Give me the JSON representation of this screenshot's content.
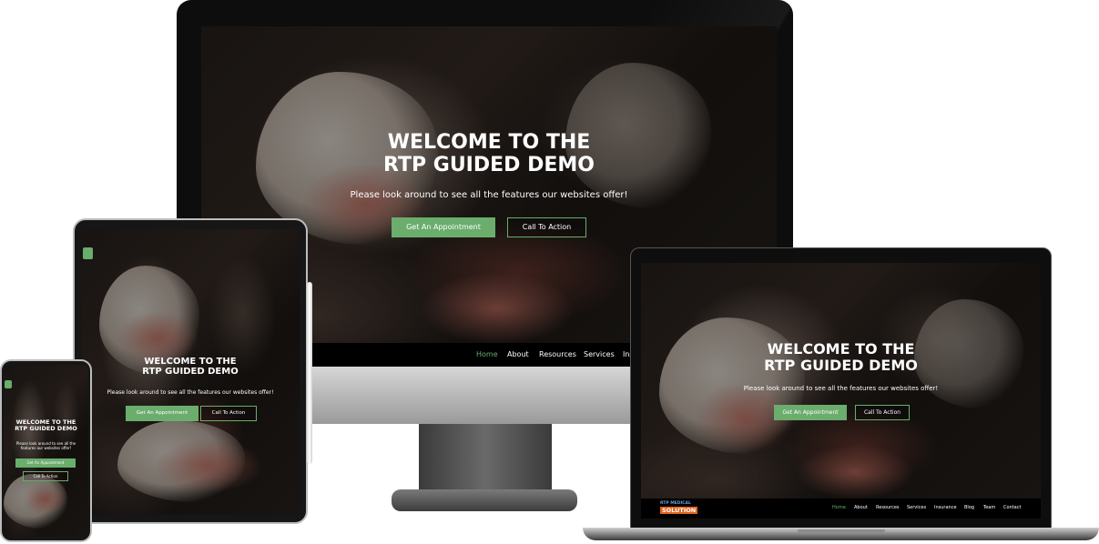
{
  "hero": {
    "title": "WELCOME TO THE\nRTP GUIDED DEMO",
    "subtitle": "Please look around to see all the features our websites offer!",
    "primary_button": "Get An Appointment",
    "secondary_button": "Call To Action"
  },
  "desktop_nav": {
    "items": [
      "Home",
      "About",
      "Resources",
      "Services",
      "Ins"
    ]
  },
  "laptop_nav": {
    "logo_top": "RTP MEDICAL",
    "logo_bottom": "SOLUTION",
    "items": [
      "Home",
      "About",
      "Resources",
      "Services",
      "Insurance",
      "Blog",
      "Team",
      "Contact"
    ]
  },
  "colors": {
    "accent": "#6aad6c",
    "device_frame": "#1a1a1a",
    "stand": "#5a5a5a"
  }
}
